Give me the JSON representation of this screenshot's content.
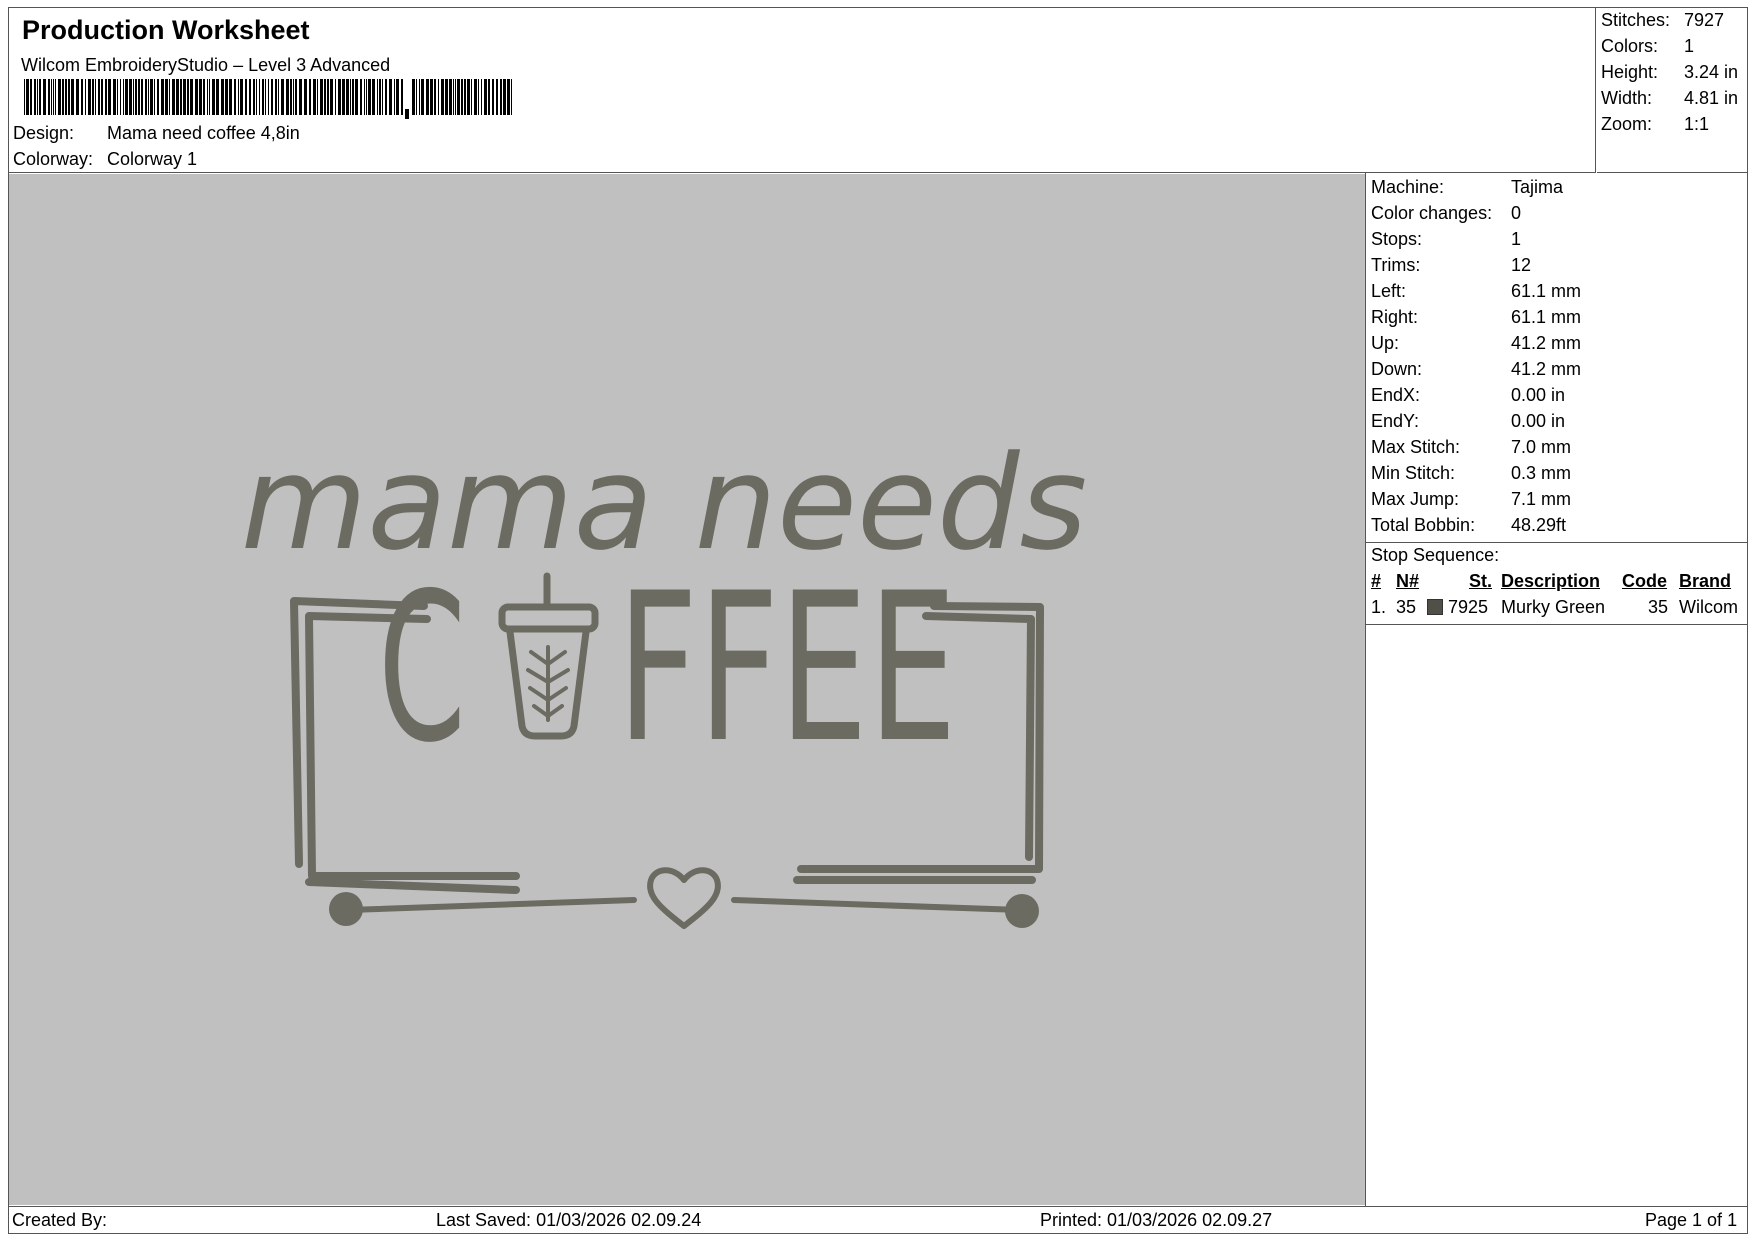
{
  "header": {
    "title": "Production Worksheet",
    "subtitle": "Wilcom EmbroideryStudio – Level 3 Advanced",
    "design_label": "Design:",
    "design_value": "Mama need coffee 4,8in",
    "colorway_label": "Colorway:",
    "colorway_value": "Colorway 1"
  },
  "summary": [
    {
      "label": "Stitches:",
      "value": "7927"
    },
    {
      "label": "Colors:",
      "value": "1"
    },
    {
      "label": "Height:",
      "value": "3.24 in"
    },
    {
      "label": "Width:",
      "value": "4.81 in"
    },
    {
      "label": "Zoom:",
      "value": "1:1"
    }
  ],
  "properties": [
    {
      "label": "Machine:",
      "value": "Tajima"
    },
    {
      "label": "Color changes:",
      "value": "0"
    },
    {
      "label": "Stops:",
      "value": "1"
    },
    {
      "label": "Trims:",
      "value": "12"
    },
    {
      "label": "Left:",
      "value": "61.1 mm"
    },
    {
      "label": "Right:",
      "value": "61.1 mm"
    },
    {
      "label": "Up:",
      "value": "41.2 mm"
    },
    {
      "label": "Down:",
      "value": "41.2 mm"
    },
    {
      "label": "EndX:",
      "value": "0.00 in"
    },
    {
      "label": "EndY:",
      "value": "0.00 in"
    },
    {
      "label": "Max Stitch:",
      "value": "7.0 mm"
    },
    {
      "label": "Min Stitch:",
      "value": "0.3 mm"
    },
    {
      "label": "Max Jump:",
      "value": "7.1 mm"
    },
    {
      "label": "Total Bobbin:",
      "value": "48.29ft"
    }
  ],
  "stop_sequence": {
    "title": "Stop Sequence:",
    "columns": {
      "num": "#",
      "n": "N#",
      "st": "St.",
      "description": "Description",
      "code": "Code",
      "brand": "Brand"
    },
    "rows": [
      {
        "num": "1.",
        "n": "35",
        "st": "7925",
        "description": "Murky Green",
        "code": "35",
        "brand": "Wilcom",
        "color": "#505048"
      }
    ]
  },
  "design_preview": {
    "line1": "mama needs",
    "word_c": "C",
    "word_rest": "FFEE",
    "thread_color": "#6b6b62"
  },
  "footer": {
    "created_by": "Created By:",
    "last_saved": "Last Saved: 01/03/2026 02.09.24",
    "printed": "Printed: 01/03/2026 02.09.27",
    "page": "Page 1 of 1"
  }
}
